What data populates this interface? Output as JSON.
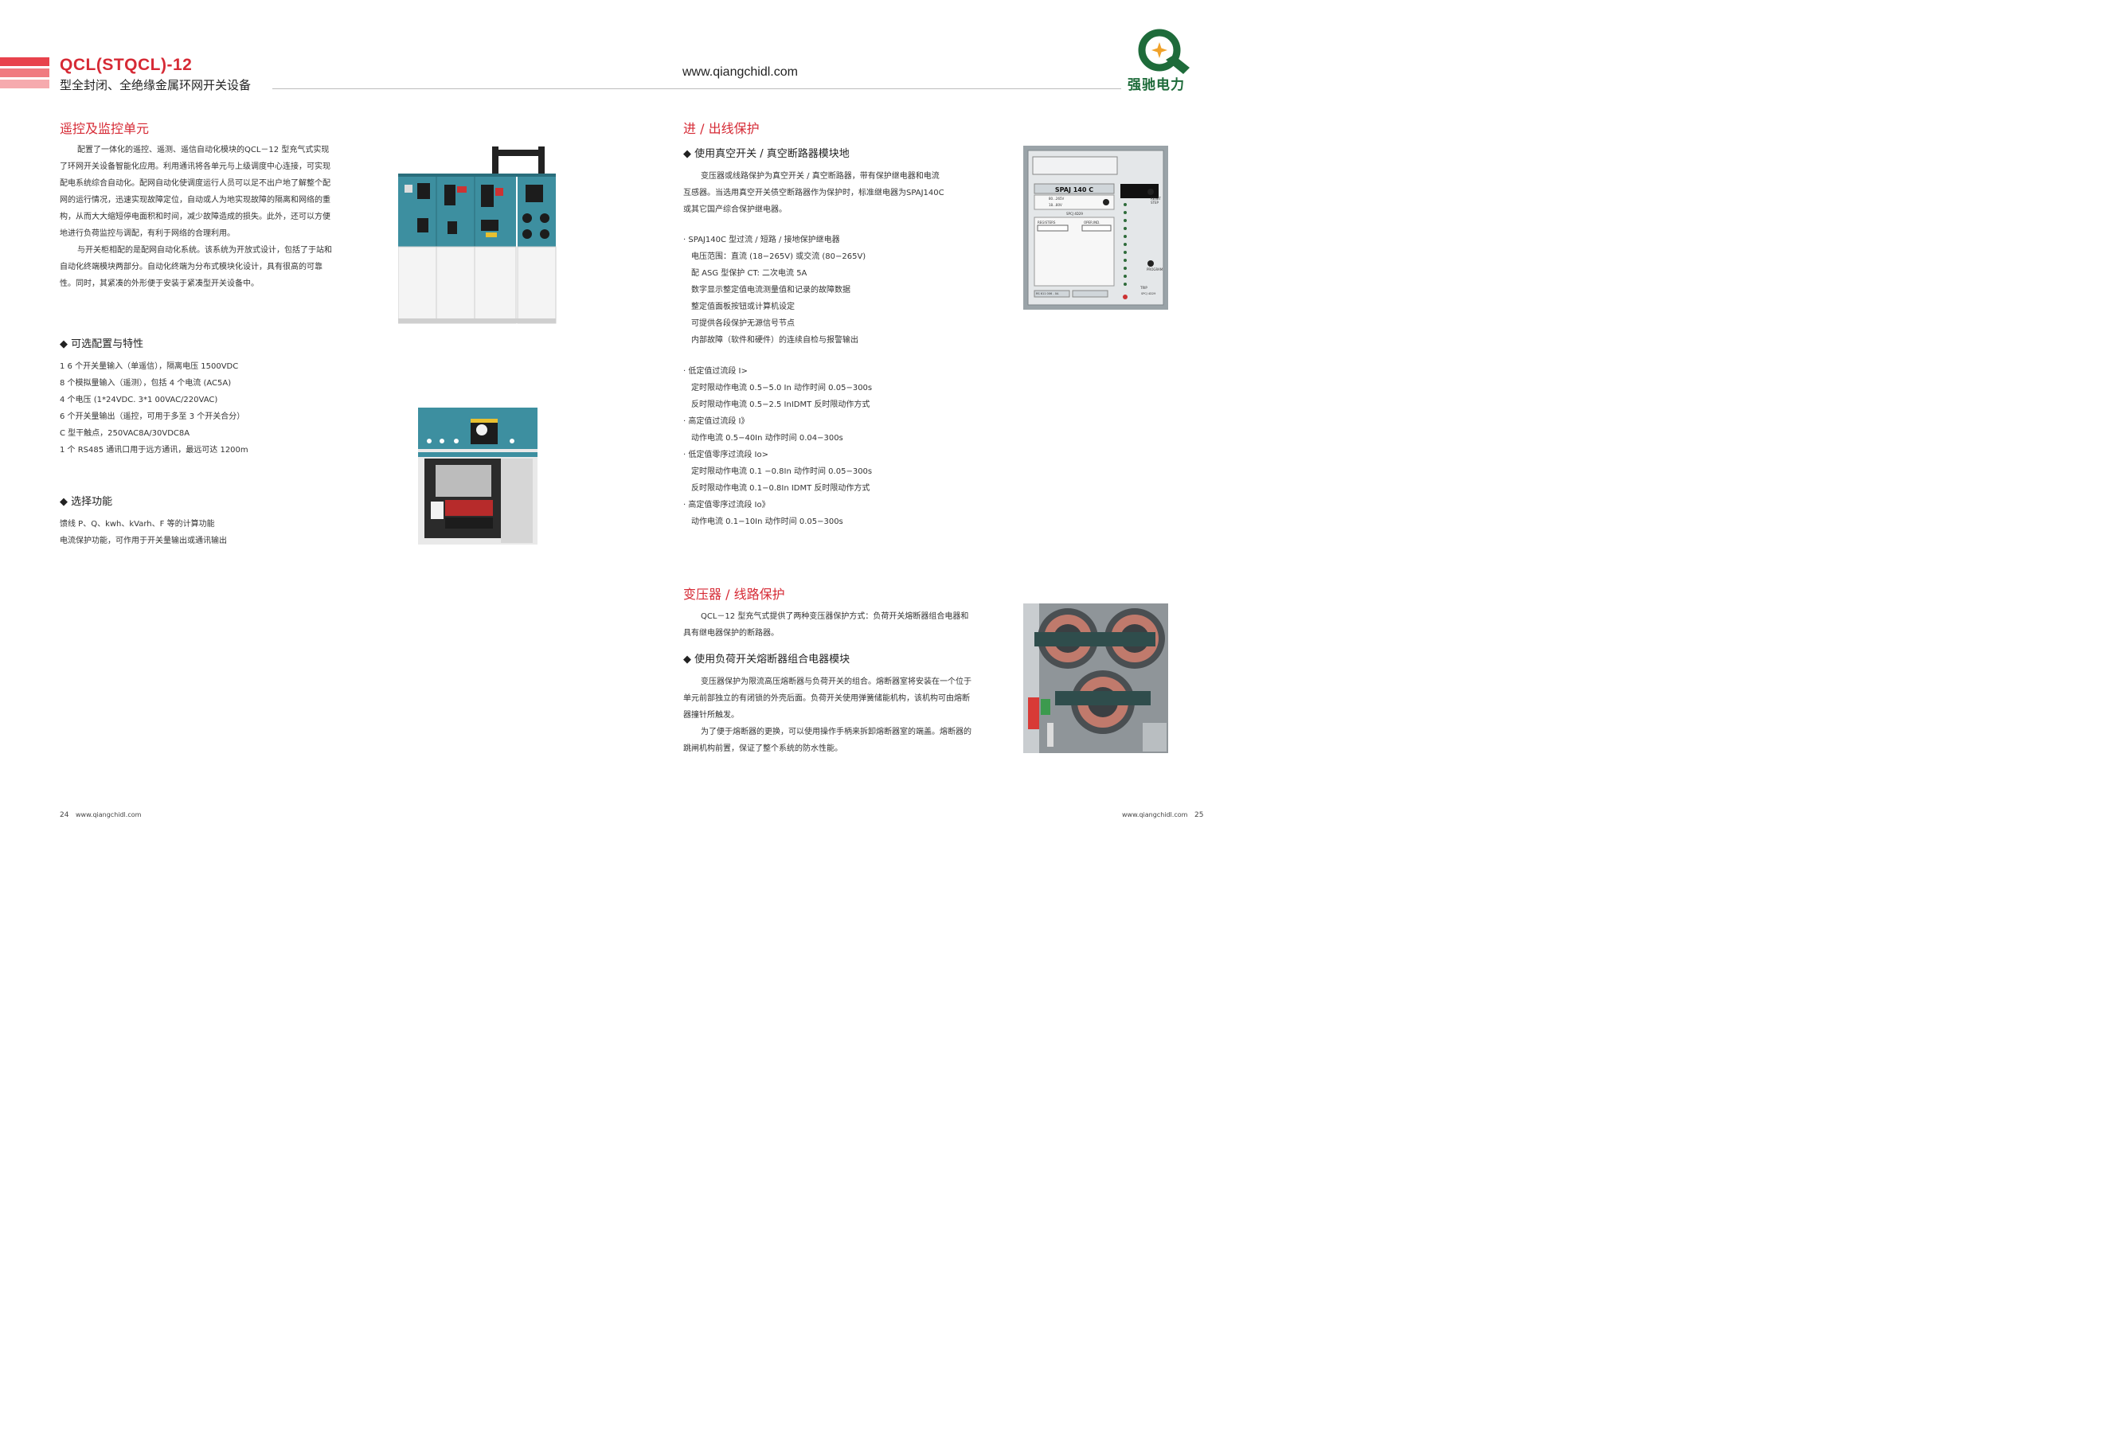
{
  "header": {
    "title": "QCL(STQCL)-12",
    "subtitle": "型全封闭、全绝缘金属环网开关设备",
    "url": "www.qiangchidl.com",
    "brand": "强驰电力",
    "accent_red": "#d62a35",
    "brand_green": "#1e6b3a",
    "brand_orange": "#f0a22a"
  },
  "left": {
    "remote": {
      "title": "遥控及监控单元",
      "paragraphs": [
        "配置了一体化的遥控、遥测、遥信自动化模块的QCL－12 型充气式实现了环网开关设备智能化应用。利用通讯将各单元与上级调度中心连接，可实现配电系统综合自动化。配网自动化使调度运行人员可以足不出户地了解整个配网的运行情况，迅速实现故障定位，自动或人为地实现故障的隔离和网络的重构，从而大大缩短停电面积和时间，减少故障造成的损失。此外，还可以方便地进行负荷监控与调配，有利于网络的合理利用。",
        "与开关柜相配的是配网自动化系统。该系统为开放式设计，包括了于站和自动化终端模块两部分。自动化终端为分布式模块化设计，具有很高的可靠性。同时，其紧凑的外形便于安装于紧凑型开关设备中。"
      ]
    },
    "options": {
      "title": "◆ 可选配置与特性",
      "items": [
        "1 6 个开关量输入（单遥信），隔离电压 1500VDC",
        "8 个模拟量输入（遥测），包括 4 个电流 (AC5A)",
        "4 个电压 (1*24VDC.  3*1 00VAC/220VAC)",
        "6 个开关量输出（遥控，可用于多至 3 个开关合分）",
        "C 型干触点，250VAC8A/30VDC8A",
        "1 个 RS485 通讯口用于远方通讯，最远可达 1200m"
      ]
    },
    "functions": {
      "title": "◆ 选择功能",
      "items": [
        "馈线 P、Q、kwh、kVarh、F 等的计算功能",
        "电流保护功能，可作用于开关量输出或通讯输出"
      ]
    }
  },
  "right": {
    "inout": {
      "title": "进 / 出线保护",
      "bullet": "◆ 使用真空开关 / 真空断路器模块地",
      "paragraph": "变压器或线路保护为真空开关 / 真空断路器，带有保护继电器和电流互感器。当选用真空开关债空断路器作为保护时，标准继电器为SPAJ140C 或其它国产综合保护继电器。",
      "list1": [
        "· SPAJ140C 型过流 / 短路 / 接地保护继电器",
        "电压范围：直流 (18−265V) 或交流 (80−265V)",
        "配 ASG 型保护 CT: 二次电流 5A",
        "数字显示整定值电流测量值和记录的故障数据",
        "整定值面板按钮或计算机设定",
        "可提供各段保护无源信号节点",
        "内部故障（软件和硬件）的连续自检与报警输出"
      ],
      "list2": [
        "· 低定值过流段 I>",
        "定时限动作电流 0.5−5.0 In 动作时间 0.05−300s",
        "反时限动作电流 0.5−2.5 InIDMT 反时限动作方式",
        "· 高定值过流段 I》",
        "动作电流 0.5−40In 动作时间 0.04−300s",
        "· 低定值零序过流段 Io>",
        "定时限动作电流 0.1 −0.8In 动作时间 0.05−300s",
        "反时限动作电流 0.1−0.8In IDMT 反时限动作方式",
        "· 高定值零序过流段 Io》",
        "动作电流 0.1−10In 动作时间 0.05−300s"
      ],
      "relay_panel": {
        "model": "SPAJ 140 C",
        "range1": "80...265V",
        "range2": "18...80V",
        "registers": "REGISTERS",
        "oper": "OPER.IND.",
        "module": "SPCJ 4D29",
        "reset": "RESET STEP",
        "program": "PROGRAM",
        "trip": "TRIP",
        "footer_left": "RS 611 006 - 0A",
        "footer_right": "SPCJ 4D29"
      }
    },
    "transformer": {
      "title": "变压器 / 线路保护",
      "intro": "QCL－12 型充气式提供了两种变压器保护方式：负荷开关熔断器组合电器和具有继电器保护的断路器。",
      "bullet": "◆ 使用负荷开关熔断器组合电器模块",
      "paragraphs": [
        "变压器保护为限流高压熔断器与负荷开关的组合。熔断器室将安装在一个位于单元前部独立的有闭锁的外壳后面。负荷开关使用弹簧储能机构，该机构可由熔断器撞针所触发。",
        "为了便于熔断器的更换，可以使用操作手柄来拆卸熔断器室的端盖。熔断器的跳闸机构前置，保证了整个系统的防水性能。"
      ]
    }
  },
  "footer": {
    "left_page": "24",
    "left_url": "www.qiangchidl.com",
    "right_url": "www.qiangchidl.com",
    "right_page": "25"
  }
}
